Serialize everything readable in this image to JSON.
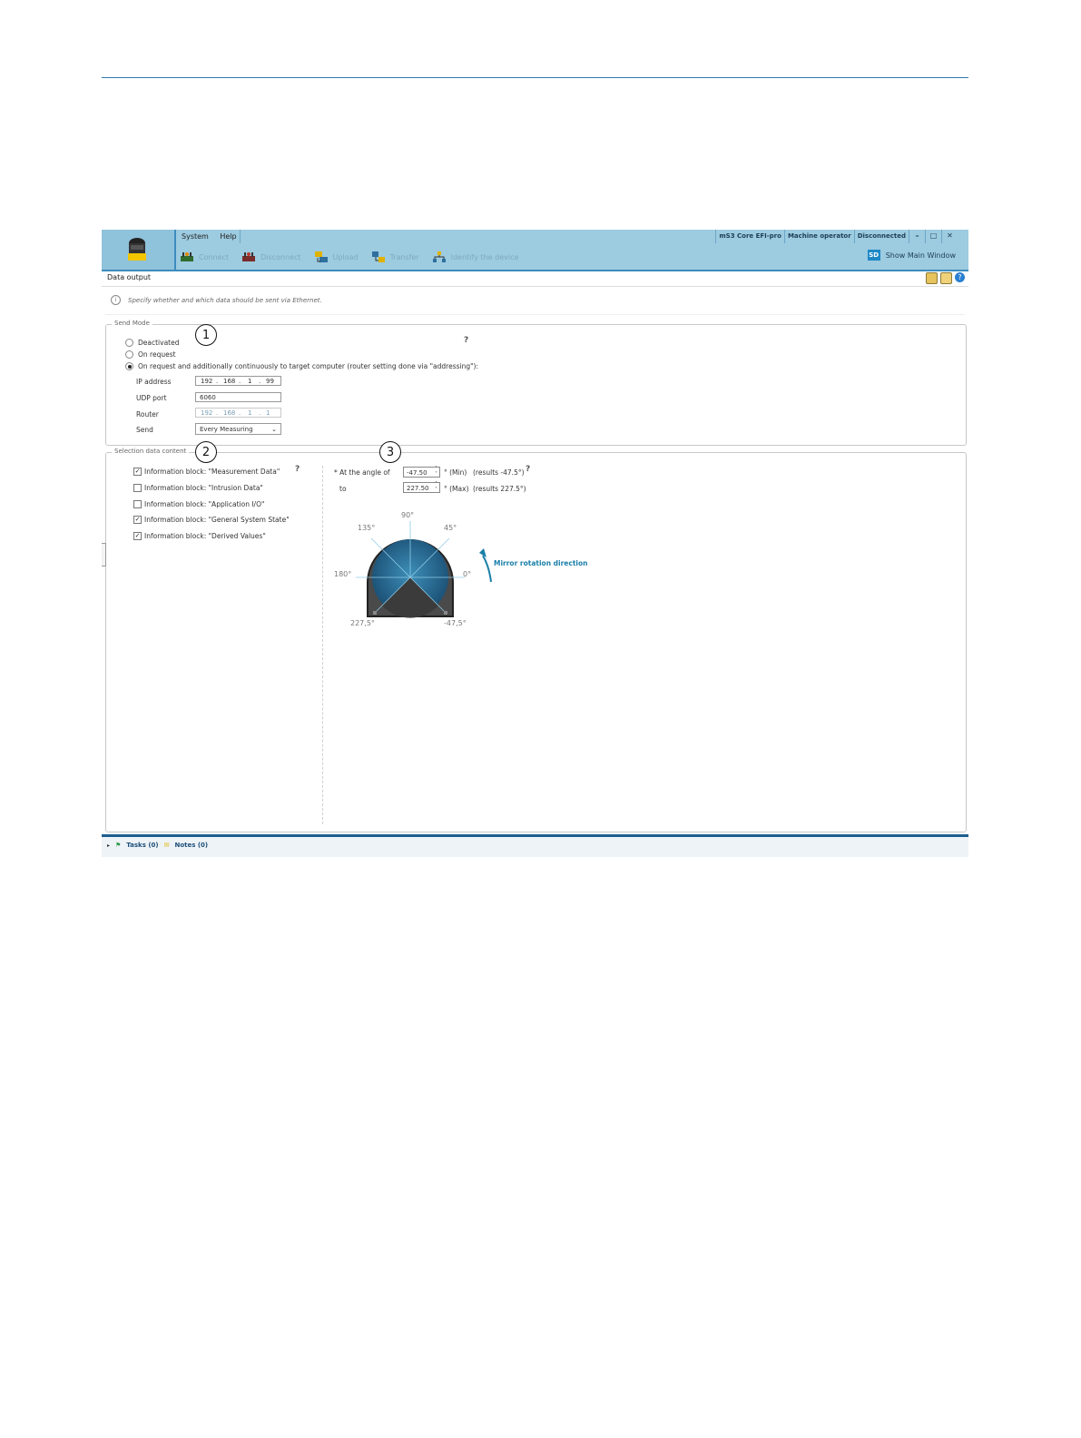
{
  "app": {
    "menu": [
      "System",
      "Help"
    ],
    "status": [
      "mS3 Core EFI-pro",
      "Machine operator",
      "Disconnected"
    ],
    "window_buttons": [
      "–",
      "□",
      "✕"
    ],
    "toolbar": [
      "Connect",
      "Disconnect",
      "Upload",
      "Transfer",
      "Identify the device"
    ],
    "show_main": {
      "badge": "SD",
      "label": "Show Main Window"
    }
  },
  "page": {
    "title": "Data output",
    "info": "Specify whether and which data should be sent via Ethernet."
  },
  "send_mode": {
    "legend": "Send Mode",
    "options": [
      "Deactivated",
      "On request",
      "On request and additionally continuously to target computer (router setting done via \"addressing\"):"
    ],
    "selected_index": 2,
    "ip_label": "IP address",
    "ip": [
      "192",
      "168",
      "1",
      "99"
    ],
    "udp_label": "UDP port",
    "udp": "6060",
    "router_label": "Router",
    "router": [
      "192",
      "168",
      "1",
      "1"
    ],
    "send_label": "Send",
    "send_value": "Every Measuring"
  },
  "selection": {
    "legend": "Selection data content",
    "blocks": [
      {
        "label": "Information block: \"Measurement Data\"",
        "checked": true
      },
      {
        "label": "Information block: \"Intrusion Data\"",
        "checked": false
      },
      {
        "label": "Information block: \"Application I/O\"",
        "checked": false
      },
      {
        "label": "Information block: \"General System State\"",
        "checked": true
      },
      {
        "label": "Information block: \"Derived Values\"",
        "checked": true
      }
    ],
    "angle_from_label": "* At the angle of",
    "angle_from_value": "-47.50",
    "angle_from_unit": "° (Min)",
    "angle_from_result": "(results -47.5°)",
    "angle_to_label": "to",
    "angle_to_value": "227.50",
    "angle_to_unit": "° (Max)",
    "angle_to_result": "(results 227.5°)"
  },
  "dial": {
    "labels": {
      "a90": "90°",
      "a135": "135°",
      "a45": "45°",
      "a180": "180°",
      "a0": "0°",
      "a227": "227,5°",
      "aneg": "-47,5°"
    },
    "mirror_text": "Mirror rotation direction",
    "accent": "#1a7fa8"
  },
  "callouts": [
    "1",
    "2",
    "3"
  ],
  "statusbar": {
    "tasks": "Tasks (0)",
    "notes": "Notes (0)"
  }
}
